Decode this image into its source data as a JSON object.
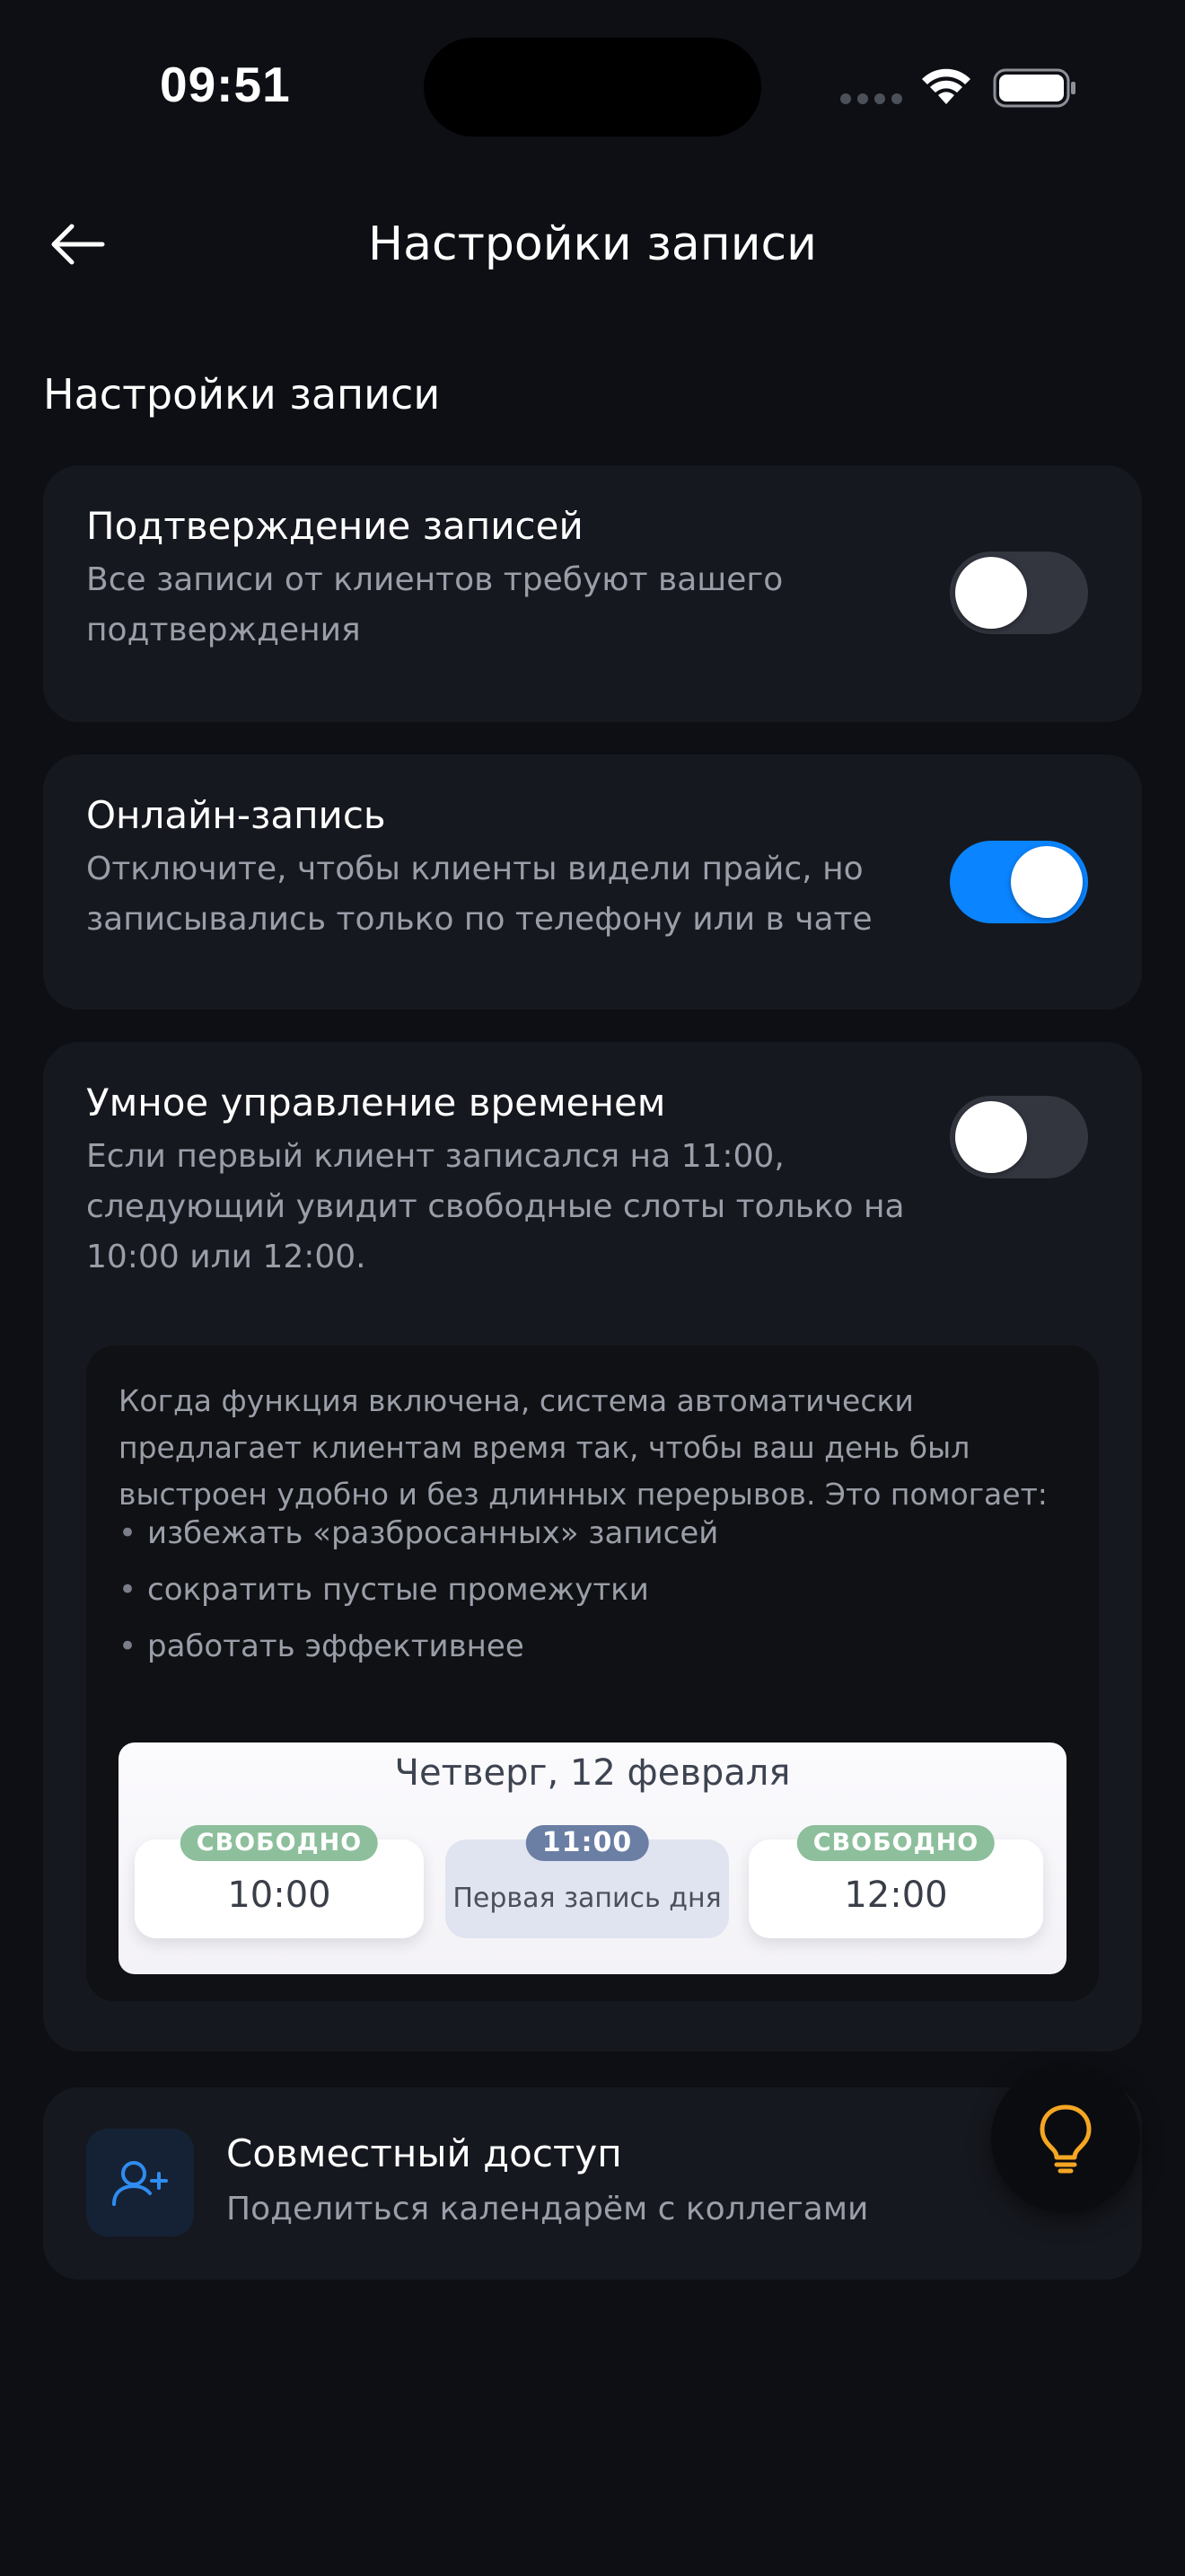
{
  "status_bar": {
    "time": "09:51"
  },
  "header": {
    "title": "Настройки записи",
    "back_icon": "arrow-left-icon"
  },
  "section": {
    "title": "Настройки записи"
  },
  "settings": [
    {
      "title": "Подтверждение записей",
      "description": "Все записи от клиентов требуют вашего подтверждения",
      "enabled": false
    },
    {
      "title": "Онлайн-запись",
      "description": "Отключите, чтобы клиенты видели прайс, но записывались только по телефону или в чате",
      "enabled": true
    },
    {
      "title": "Умное управление временем",
      "description": "Если первый клиент записался на 11:00, следующий увидит свободные слоты только на 10:00 или 12:00.",
      "enabled": false
    }
  ],
  "smart_info": {
    "text": "Когда функция включена, система автоматически предлагает клиентам время так, чтобы ваш день был выстроен удобно и без длинных перерывов. Это помогает:",
    "bullets": [
      "избежать «разбросанных» записей",
      "сократить пустые промежутки",
      "работать эффективнее"
    ],
    "illustration": {
      "date": "Четверг, 12 февраля",
      "slots": [
        {
          "badge": "СВОБОДНО",
          "time": "10:00"
        },
        {
          "badge": "11:00",
          "caption": "Первая запись дня"
        },
        {
          "badge": "СВОБОДНО",
          "time": "12:00"
        }
      ]
    }
  },
  "shared_access": {
    "title": "Совместный доступ",
    "subtitle": "Поделиться календарём с коллегами",
    "icon": "user-plus-icon"
  },
  "tip_button": {
    "icon": "lightbulb-icon"
  },
  "colors": {
    "background": "#0d0f14",
    "card": "#16181f",
    "accent": "#0a84ff",
    "tip": "#f5a623",
    "free_badge": "#8dbf9c",
    "booked_badge": "#6b7ea4"
  }
}
